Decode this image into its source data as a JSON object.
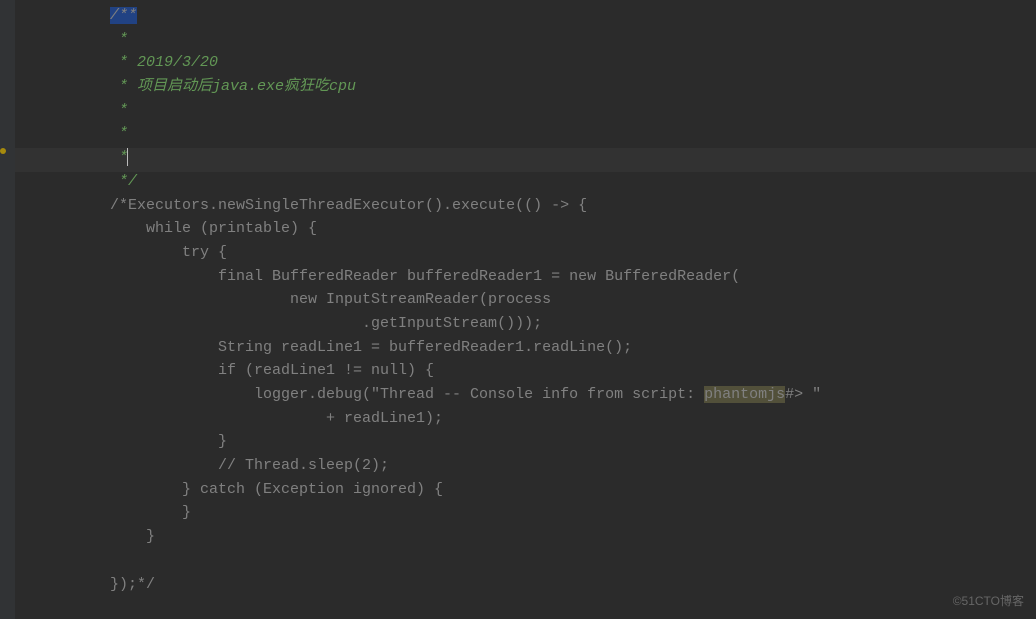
{
  "lines": {
    "l1": "/**",
    "l2": " *",
    "l3": " * 2019/3/20",
    "l4": " * 项目启动后java.exe疯狂吃cpu",
    "l5": " *",
    "l6": " *",
    "l7": " *",
    "l8": " */",
    "l9": "/*Executors.newSingleThreadExecutor().execute(() -> {",
    "l10": "    while (printable) {",
    "l11": "        try {",
    "l12": "            final BufferedReader bufferedReader1 = new BufferedReader(",
    "l13": "                    new InputStreamReader(process",
    "l14": "                            .getInputStream()));",
    "l15": "            String readLine1 = bufferedReader1.readLine();",
    "l16": "            if (readLine1 != null) {",
    "l17_a": "                logger.debug(\"Thread -- Console info from script: ",
    "l17_b": "phantomjs",
    "l17_c": "#> \"",
    "l18": "                        + readLine1);",
    "l19": "            }",
    "l20": "            // Thread.sleep(2);",
    "l21": "        } catch (Exception ignored) {",
    "l22": "        }",
    "l23": "    }",
    "l24": "",
    "l25": "});*/"
  },
  "watermark": "©51CTO博客"
}
